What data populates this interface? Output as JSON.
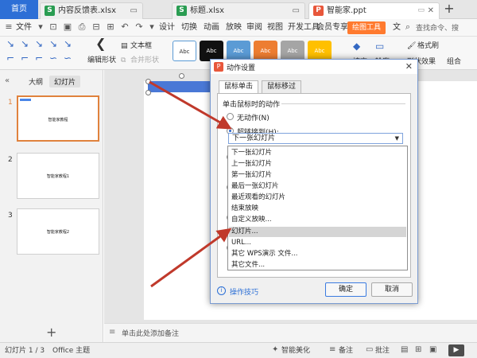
{
  "tabs": {
    "home": "首页",
    "docs": [
      {
        "label": "内容反馈表.xlsx",
        "icon_letter": "S",
        "icon_color": "#2a9d52"
      },
      {
        "label": "标题.xlsx",
        "icon_letter": "S",
        "icon_color": "#2a9d52"
      },
      {
        "label": "智能家.ppt",
        "icon_letter": "P",
        "icon_color": "#e8573b"
      }
    ]
  },
  "menu": {
    "file": "文件",
    "items": [
      "设计",
      "切换",
      "动画",
      "放映",
      "审阅",
      "视图",
      "开发工具",
      "会员专享"
    ],
    "drawing_tools": "绘图工具",
    "text_tools": "文",
    "search": "查找命令、搜"
  },
  "ribbon": {
    "edit_shape": "编辑形状",
    "text_box": "文本框",
    "merge_shape": "合并形状",
    "style_label": "Abc",
    "format_painter": "格式刷",
    "fill": "填充",
    "outline": "轮廓",
    "shape_effect": "形状效果",
    "group": "组合",
    "style_colors": [
      "#ffffff",
      "#111111",
      "#5b9bd5",
      "#ed7d31",
      "#a5a5a5",
      "#ffc000"
    ]
  },
  "left_panel": {
    "outline_tab": "大纲",
    "slides_tab": "幻灯片",
    "slides": [
      {
        "number": "1",
        "text": "智能家教程"
      },
      {
        "number": "2",
        "text": "智能家教程1"
      },
      {
        "number": "3",
        "text": "智能家教程2"
      }
    ],
    "add_slide": "+"
  },
  "notes": {
    "placeholder": "单击此处添加备注"
  },
  "status": {
    "slide_info": "幻灯片 1 / 3",
    "theme": "Office 主题",
    "beautify": "智能美化",
    "notes": "备注",
    "comments": "批注",
    "play": "▶"
  },
  "dialog": {
    "title": "动作设置",
    "tabs": [
      "鼠标单击",
      "鼠标移过"
    ],
    "group_label": "单击鼠标时的动作",
    "options": {
      "no_action": "无动作(N)",
      "hyperlink": "超链接到(H):"
    },
    "combo_value": "下一张幻灯片",
    "dropdown_items": [
      "下一张幻灯片",
      "上一张幻灯片",
      "第一张幻灯片",
      "最后一张幻灯片",
      "最近观看的幻灯片",
      "结束放映",
      "自定义放映...",
      "幻灯片...",
      "URL...",
      "其它 WPS演示 文件...",
      "其它文件..."
    ],
    "highlighted_item": "幻灯片...",
    "tips": "操作技巧",
    "ok": "确定",
    "cancel": "取消"
  }
}
